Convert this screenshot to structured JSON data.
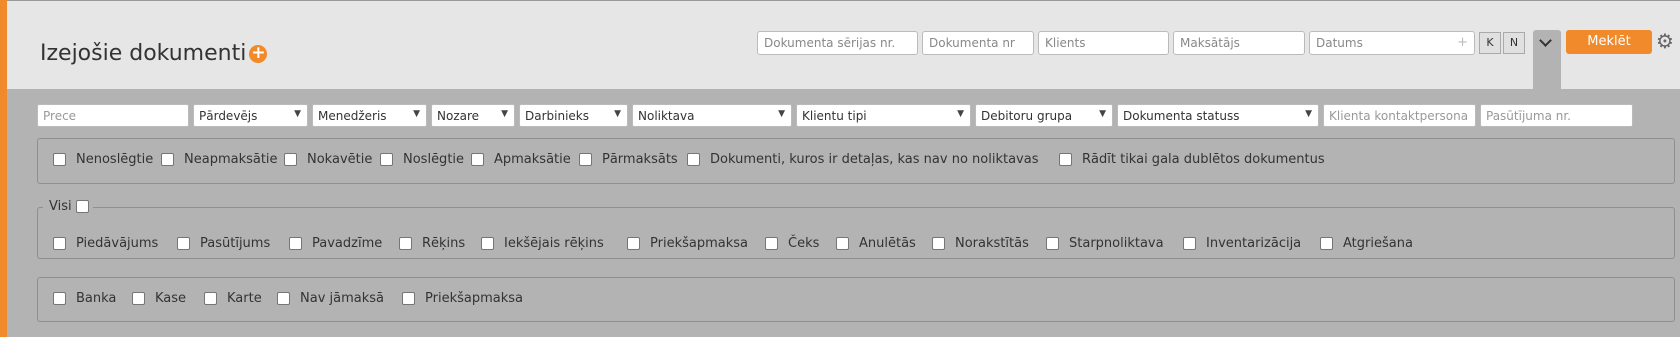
{
  "header": {
    "title": "Izejošie dokumenti",
    "add_icon": "plus-circle-icon",
    "accent_color": "#f08a2a"
  },
  "top_search": {
    "series_placeholder": "Dokumenta sērijas nr.",
    "number_placeholder": "Dokumenta nr",
    "client_placeholder": "Klients",
    "payer_placeholder": "Maksātājs",
    "date_placeholder": "Datums",
    "date_plus": "+",
    "k_label": "K",
    "n_label": "N",
    "search_label": "Meklēt",
    "expand_icon": "chevron-down-icon",
    "settings_icon": "gear-icon"
  },
  "filters": {
    "product_placeholder": "Prece",
    "seller": "Pārdevējs",
    "manager": "Menedžeris",
    "industry": "Nozare",
    "employee": "Darbinieks",
    "warehouse": "Noliktava",
    "client_types": "Klientu tipi",
    "debtor_group": "Debitoru grupa",
    "doc_status": "Dokumenta statuss",
    "contact_placeholder": "Klienta kontaktpersona",
    "order_placeholder": "Pasūtījuma nr.",
    "arrow": "▼"
  },
  "status_checks": [
    "Nenoslēgtie",
    "Neapmaksātie",
    "Nokavētie",
    "Noslēgtie",
    "Apmaksātie",
    "Pārmaksāts",
    "Dokumenti, kuros ir detaļas, kas nav no noliktavas",
    "Rādīt tikai gala dublētos dokumentus"
  ],
  "doc_types": {
    "legend": "Visi",
    "items": [
      "Piedāvājums",
      "Pasūtījums",
      "Pavadzīme",
      "Rēķins",
      "Iekšējais rēķins",
      "Priekšapmaksa",
      "Čeks",
      "Anulētās",
      "Norakstītās",
      "Starpnoliktava",
      "Inventarizācija",
      "Atgriešana"
    ]
  },
  "payment_types": [
    "Banka",
    "Kase",
    "Karte",
    "Nav jāmaksā",
    "Priekšapmaksa"
  ]
}
